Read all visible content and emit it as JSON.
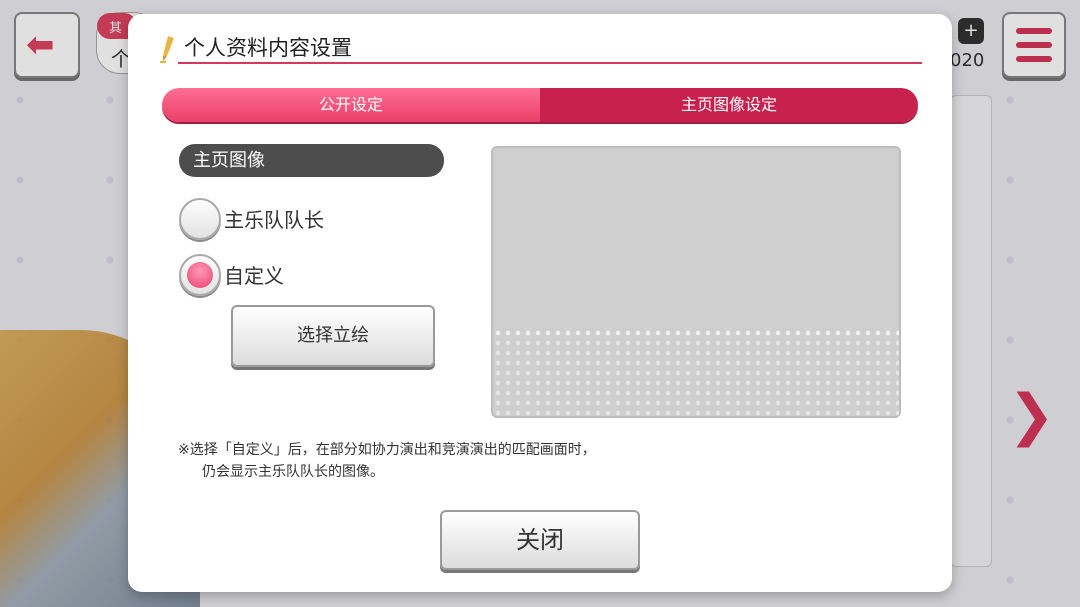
{
  "background": {
    "top_tag_badge": "其",
    "top_tag_char": "个",
    "counter_plus": "+",
    "counter_value": "020",
    "back_arrow": "⬅",
    "next_arrow": "❯"
  },
  "dialog": {
    "title": "个人资料内容设置",
    "tabs": [
      {
        "label": "公开设定",
        "active": false
      },
      {
        "label": "主页图像设定",
        "active": true
      }
    ],
    "section_header": "主页图像",
    "options": [
      {
        "label": "主乐队队长",
        "selected": false
      },
      {
        "label": "自定义",
        "selected": true
      }
    ],
    "select_button": "选择立绘",
    "note_line1": "※选择「自定义」后，在部分如协力演出和竞演演出的匹配画面时，",
    "note_line2": "仍会显示主乐队队长的图像。",
    "close_button": "关闭"
  },
  "colors": {
    "accent": "#d8365a",
    "tab_active": "#c8214d",
    "tab_inactive": "#ea3f69",
    "header_bg": "#4d4d4d"
  },
  "icons": {
    "title_icon": "pencil-icon",
    "back": "arrow-left-icon",
    "menu": "hamburger-menu-icon",
    "next": "chevron-right-icon"
  }
}
